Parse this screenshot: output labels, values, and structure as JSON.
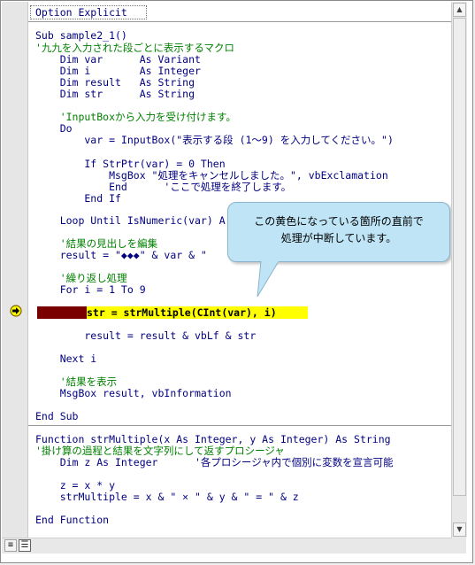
{
  "editor": {
    "lines": [
      {
        "text": "Option Explicit",
        "kind": "keyword",
        "y": 0
      },
      {
        "text": "Sub sample2_1()",
        "kind": "keyword",
        "y": 1
      },
      {
        "text": "'九九を入力された段ごとに表示するマクロ",
        "kind": "comment",
        "y": 2
      },
      {
        "text": "    Dim var      As Variant",
        "kind": "keyword",
        "y": 3
      },
      {
        "text": "    Dim i        As Integer",
        "kind": "keyword",
        "y": 4
      },
      {
        "text": "    Dim result   As String",
        "kind": "keyword",
        "y": 5
      },
      {
        "text": "    Dim str      As String",
        "kind": "keyword",
        "y": 6
      },
      {
        "text": "    'InputBoxから入力を受け付けます。",
        "kind": "comment",
        "y": 7
      },
      {
        "text": "    Do",
        "kind": "keyword",
        "y": 8
      },
      {
        "text": "        var = InputBox(\"表示する段 (1～9) を入力してください。\")",
        "kind": "keyword",
        "y": 9
      },
      {
        "text": "        If StrPtr(var) = 0 Then",
        "kind": "keyword",
        "y": 10
      },
      {
        "text": "            MsgBox \"処理をキャンセルしました。\", vbExclamation",
        "kind": "keyword",
        "y": 11
      },
      {
        "text": "            End      'ここで処理を終了します。",
        "kind": "mixed",
        "y": 12
      },
      {
        "text": "        End If",
        "kind": "keyword",
        "y": 13
      },
      {
        "text": "    Loop Until IsNumeric(var) A",
        "kind": "keyword",
        "y": 14
      },
      {
        "text": "    '結果の見出しを編集",
        "kind": "comment",
        "y": 15
      },
      {
        "text": "    result = \"◆◆◆\" & var & \"",
        "kind": "keyword",
        "y": 16
      },
      {
        "text": "    '繰り返し処理",
        "kind": "comment",
        "y": 17
      },
      {
        "text": "    For i = 1 To 9",
        "kind": "keyword",
        "y": 18
      },
      {
        "text": "        result = result & vbLf & str",
        "kind": "keyword",
        "y": 19
      },
      {
        "text": "    Next i",
        "kind": "keyword",
        "y": 20
      },
      {
        "text": "    '結果を表示",
        "kind": "comment",
        "y": 21
      },
      {
        "text": "    MsgBox result, vbInformation",
        "kind": "keyword",
        "y": 22
      },
      {
        "text": "End Sub",
        "kind": "keyword",
        "y": 23
      },
      {
        "text": "Function strMultiple(x As Integer, y As Integer) As String",
        "kind": "keyword",
        "y": 24
      },
      {
        "text": "'掛け算の過程と結果を文字列にして返すプロシージャ",
        "kind": "comment",
        "y": 25
      },
      {
        "text": "    Dim z As Integer      '各プロシージャ内で個別に変数を宣言可能",
        "kind": "mixed",
        "y": 26
      },
      {
        "text": "    z = x * y",
        "kind": "keyword",
        "y": 27
      },
      {
        "text": "    strMultiple = x & \" × \" & y & \" = \" & z",
        "kind": "keyword",
        "y": 28
      },
      {
        "text": "End Function",
        "kind": "keyword",
        "y": 29
      }
    ],
    "current_line": "str = strMultiple(CInt(var), i)"
  },
  "callout": {
    "line1": "この黄色になっている箇所の直前で",
    "line2": "処理が中断しています。"
  },
  "colors": {
    "keyword": "#000080",
    "comment": "#008000",
    "highlight": "#ffff00",
    "breakpoint": "#7a0000",
    "callout_bg": "#bfe4f5"
  },
  "icons": {
    "exec_arrow": "execution-pointer-icon",
    "proc_view": "procedure-view-icon",
    "module_view": "full-module-view-icon"
  }
}
